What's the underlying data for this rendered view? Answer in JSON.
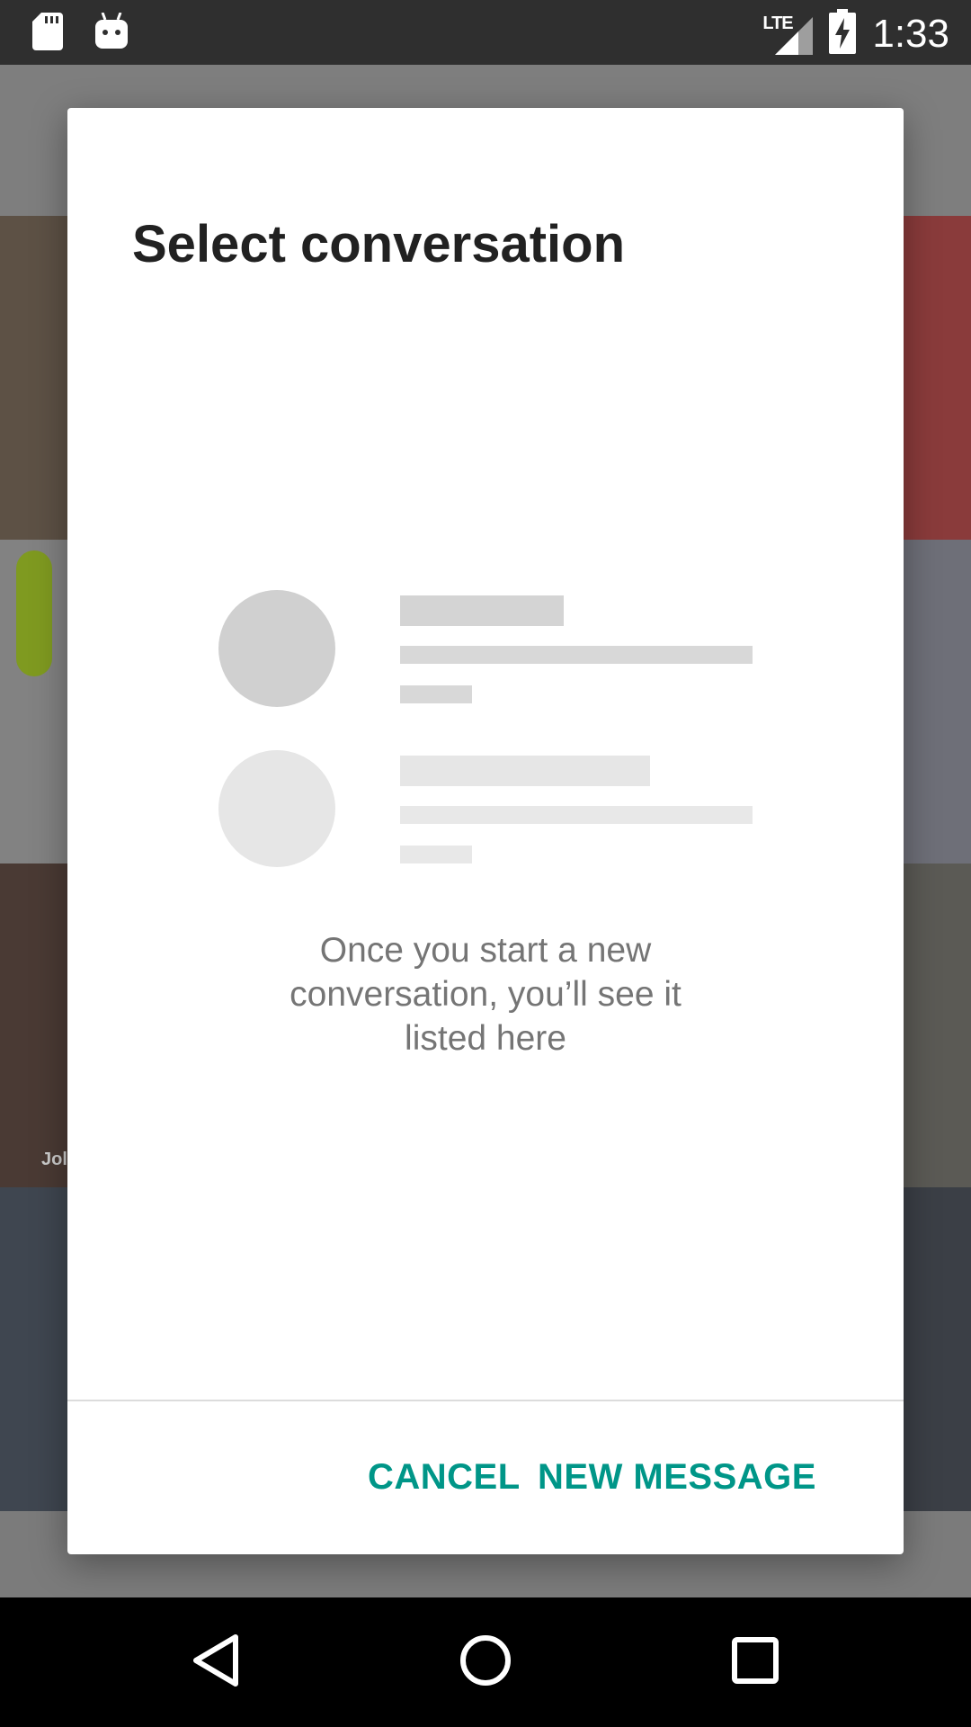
{
  "status_bar": {
    "time": "1:33",
    "network": "LTE",
    "icons": [
      "sd-card-icon",
      "android-debug-icon",
      "signal-icon",
      "battery-charging-icon"
    ]
  },
  "dialog": {
    "title": "Select conversation",
    "empty_message": "Once you start a new conversation, you’ll see it listed here",
    "cancel_label": "CANCEL",
    "new_message_label": "NEW MESSAGE",
    "accent_color": "#009688"
  },
  "background": {
    "caption": "Jol"
  },
  "nav_bar": {
    "icons": [
      "back-icon",
      "home-icon",
      "recents-icon"
    ]
  }
}
